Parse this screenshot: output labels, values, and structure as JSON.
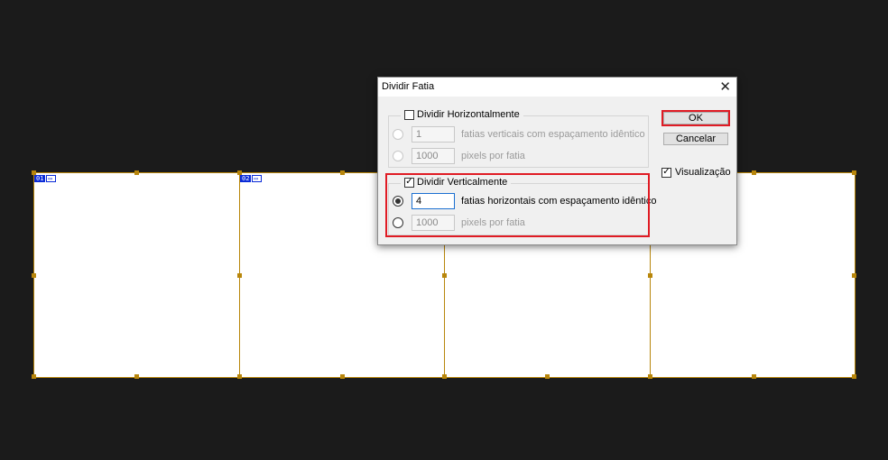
{
  "dialog": {
    "title": "Dividir Fatia",
    "close_glyph": "✕",
    "horizontal": {
      "label": "Dividir Horizontalmente",
      "checked": false,
      "count_value": "1",
      "count_label": "fatias verticais com espaçamento idêntico",
      "pixels_value": "1000",
      "pixels_label": "pixels por fatia"
    },
    "vertical": {
      "label": "Dividir Verticalmente",
      "checked": true,
      "check_glyph": "✓",
      "count_value": "4",
      "count_label": "fatias horizontais com espaçamento idêntico",
      "pixels_value": "1000",
      "pixels_label": "pixels por fatia"
    },
    "ok_label": "OK",
    "cancel_label": "Cancelar",
    "preview_label": "Visualização",
    "preview_glyph": "✓",
    "highlight_color": "#e01b24"
  },
  "canvas": {
    "slices": [
      {
        "number": "01",
        "icon": "slice-icon"
      },
      {
        "number": "02",
        "icon": "slice-icon"
      }
    ],
    "slice_color": "#b8860b"
  }
}
